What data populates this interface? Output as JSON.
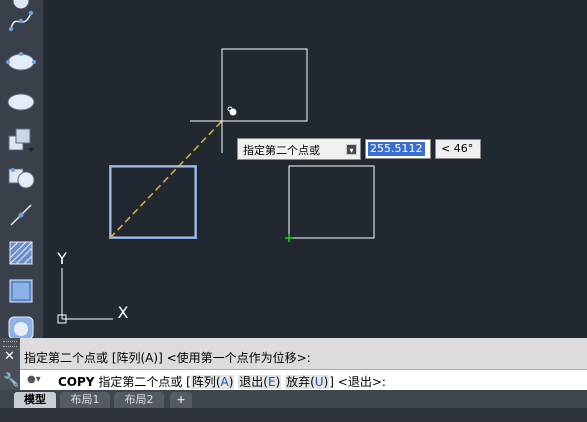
{
  "tooltip": {
    "label": "指定第二个点或",
    "dropdown_icon": "dropdown-arrow-icon"
  },
  "distance_value": "255.5112",
  "angle_value": "< 46°",
  "command": {
    "history": "指定第二个点或 [阵列(A)] <使用第一个点作为位移>:",
    "name": "COPY",
    "prompt": "指定第二个点或",
    "bracket_open": "[",
    "bracket_close": "]",
    "options": [
      {
        "label": "阵列(",
        "key": "A",
        "close": ")"
      },
      {
        "label": "退出(",
        "key": "E",
        "close": ")"
      },
      {
        "label": "放弃(",
        "key": "U",
        "close": ")"
      }
    ],
    "default": "<退出>:"
  },
  "ucs": {
    "x_label": "X",
    "y_label": "Y"
  },
  "tabs": [
    {
      "label": "模型",
      "active": true
    },
    {
      "label": "布局1",
      "active": false
    },
    {
      "label": "布局2",
      "active": false
    },
    {
      "label": "+",
      "active": false
    }
  ],
  "colors": {
    "canvas": "#212830",
    "geometry": "#ffffff",
    "selected": "#7aa6e6",
    "rubber_band": "#e0b040",
    "base_point": "#22cc22"
  }
}
